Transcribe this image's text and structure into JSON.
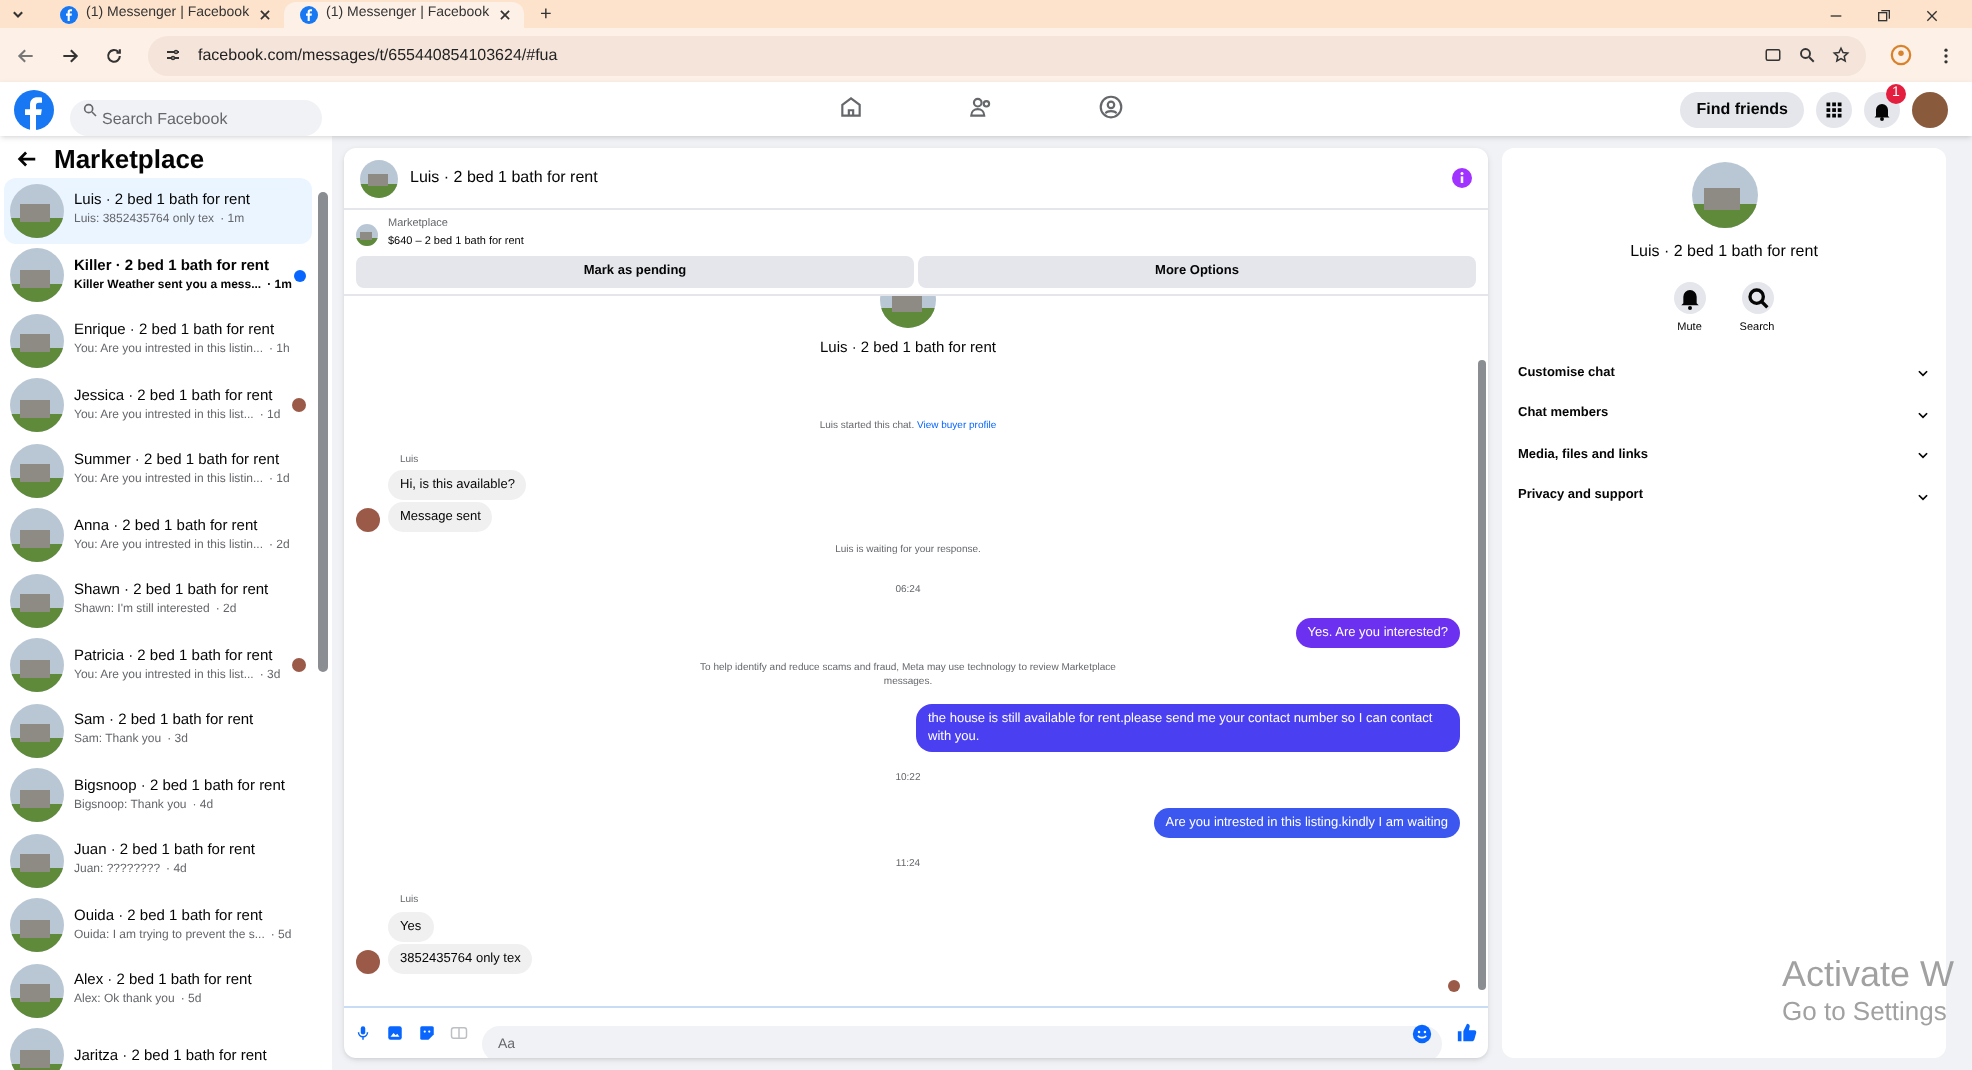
{
  "browser": {
    "tabs": [
      {
        "title": "(1) Messenger | Facebook",
        "selected": false
      },
      {
        "title": "(1) Messenger | Facebook",
        "selected": true
      }
    ],
    "new_tab": "+",
    "url": "facebook.com/messages/t/655440854103624/#fua"
  },
  "header": {
    "search": {
      "placeholder": "Search Facebook"
    },
    "find_friends": "Find friends",
    "notification_count": "1"
  },
  "sidebar": {
    "title": "Marketplace",
    "conversations": [
      {
        "title": "Luis · 2 bed 1 bath for rent",
        "preview": "Luis: 3852435764 only tex",
        "time": "· 1m",
        "selected": true,
        "seen": false,
        "unread": false
      },
      {
        "title": "Killer · 2 bed 1 bath for rent",
        "preview": "Killer Weather sent you a mess...",
        "time": "· 1m",
        "selected": false,
        "seen": false,
        "unread": true
      },
      {
        "title": "Enrique · 2 bed 1 bath for rent",
        "preview": "You: Are you intrested in this listin...",
        "time": "· 1h",
        "selected": false,
        "seen": false,
        "unread": false
      },
      {
        "title": "Jessica · 2 bed 1 bath for rent",
        "preview": "You: Are you intrested in this list...",
        "time": "· 1d",
        "selected": false,
        "seen": true,
        "unread": false
      },
      {
        "title": "Summer · 2 bed 1 bath for rent",
        "preview": "You: Are you intrested in this listin...",
        "time": "· 1d",
        "selected": false,
        "seen": false,
        "unread": false
      },
      {
        "title": "Anna · 2 bed 1 bath for rent",
        "preview": "You: Are you intrested in this listin...",
        "time": "· 2d",
        "selected": false,
        "seen": false,
        "unread": false
      },
      {
        "title": "Shawn · 2 bed 1 bath for rent",
        "preview": "Shawn: I'm still interested",
        "time": "· 2d",
        "selected": false,
        "seen": false,
        "unread": false
      },
      {
        "title": "Patricia · 2 bed 1 bath for rent",
        "preview": "You: Are you intrested in this list...",
        "time": "· 3d",
        "selected": false,
        "seen": true,
        "unread": false
      },
      {
        "title": "Sam · 2 bed 1 bath for rent",
        "preview": "Sam: Thank you",
        "time": "· 3d",
        "selected": false,
        "seen": false,
        "unread": false
      },
      {
        "title": "Bigsnoop · 2 bed 1 bath for rent",
        "preview": "Bigsnoop: Thank you",
        "time": "· 4d",
        "selected": false,
        "seen": false,
        "unread": false
      },
      {
        "title": "Juan · 2 bed 1 bath for rent",
        "preview": "Juan: ????????",
        "time": "· 4d",
        "selected": false,
        "seen": false,
        "unread": false
      },
      {
        "title": "Ouida · 2 bed 1 bath for rent",
        "preview": "Ouida: I am trying to prevent the s...",
        "time": "· 5d",
        "selected": false,
        "seen": false,
        "unread": false
      },
      {
        "title": "Alex · 2 bed 1 bath for rent",
        "preview": "Alex: Ok thank you",
        "time": "· 5d",
        "selected": false,
        "seen": false,
        "unread": false
      },
      {
        "title": "Jaritza · 2 bed 1 bath for rent",
        "selected": false
      }
    ]
  },
  "chat": {
    "title": "Luis · 2 bed 1 bath for rent",
    "listing": {
      "label": "Marketplace",
      "price_title": "$640 – 2 bed 1 bath for rent"
    },
    "actions": [
      "Mark as pending",
      "More Options"
    ],
    "messages": [
      {
        "kind": "profile",
        "text": "Luis · 2 bed 1 bath for rent"
      },
      {
        "kind": "system",
        "text": "Luis started this chat.",
        "link": "View buyer profile"
      },
      {
        "kind": "sender",
        "text": "Luis"
      },
      {
        "kind": "incoming",
        "text": "Hi, is this available?",
        "avatar": false
      },
      {
        "kind": "incoming",
        "text": "Message sent",
        "avatar": true
      },
      {
        "kind": "system",
        "text": "Luis is waiting for your response."
      },
      {
        "kind": "time",
        "text": "06:24"
      },
      {
        "kind": "outgoing",
        "text": "Yes. Are you interested?"
      },
      {
        "kind": "notice",
        "text": "To help identify and reduce scams and fraud, Meta may use technology to review Marketplace messages."
      },
      {
        "kind": "outgoing",
        "text": "the house is still available for rent.please send me your contact number so I can contact with you."
      },
      {
        "kind": "time",
        "text": "10:22"
      },
      {
        "kind": "outgoing",
        "text": "Are you intrested in this listing.kindly I am waiting"
      },
      {
        "kind": "time",
        "text": "11:24"
      },
      {
        "kind": "sender",
        "text": "Luis"
      },
      {
        "kind": "incoming",
        "text": "Yes",
        "avatar": false
      },
      {
        "kind": "incoming",
        "text": "3852435764 only tex",
        "avatar": true
      },
      {
        "kind": "seen"
      }
    ],
    "composer": {
      "placeholder": "Aa"
    }
  },
  "details": {
    "title": "Luis · 2 bed 1 bath for rent",
    "actions": [
      "Mute",
      "Search"
    ],
    "sections": [
      {
        "label": "Customise chat",
        "expanded": false
      },
      {
        "label": "Chat members",
        "expanded": false
      },
      {
        "label": "Media, files and links",
        "expanded": false
      },
      {
        "label": "Privacy and support",
        "expanded": false
      }
    ]
  },
  "os_notice": {
    "title": "Activate W",
    "subtitle": "Go to Settings"
  }
}
